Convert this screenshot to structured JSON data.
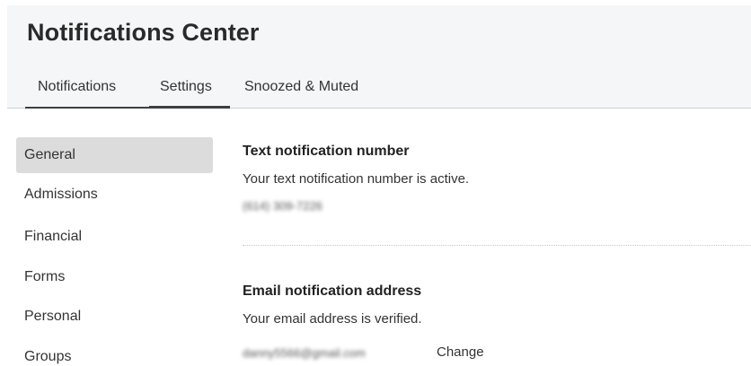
{
  "header": {
    "title": "Notifications Center",
    "tabs": [
      {
        "label": "Notifications"
      },
      {
        "label": "Settings"
      },
      {
        "label": "Snoozed & Muted"
      }
    ]
  },
  "sidebar": {
    "items": [
      {
        "label": "General"
      },
      {
        "label": "Admissions"
      },
      {
        "label": "Financial"
      },
      {
        "label": "Forms"
      },
      {
        "label": "Personal"
      },
      {
        "label": "Groups"
      }
    ]
  },
  "text_notification": {
    "title": "Text notification number",
    "description": "Your text notification number is active.",
    "number": "(614) 309-7226"
  },
  "email_notification": {
    "title": "Email notification address",
    "description": "Your email address is verified.",
    "email": "danny5566@gmail.com",
    "change_label": "Change"
  }
}
